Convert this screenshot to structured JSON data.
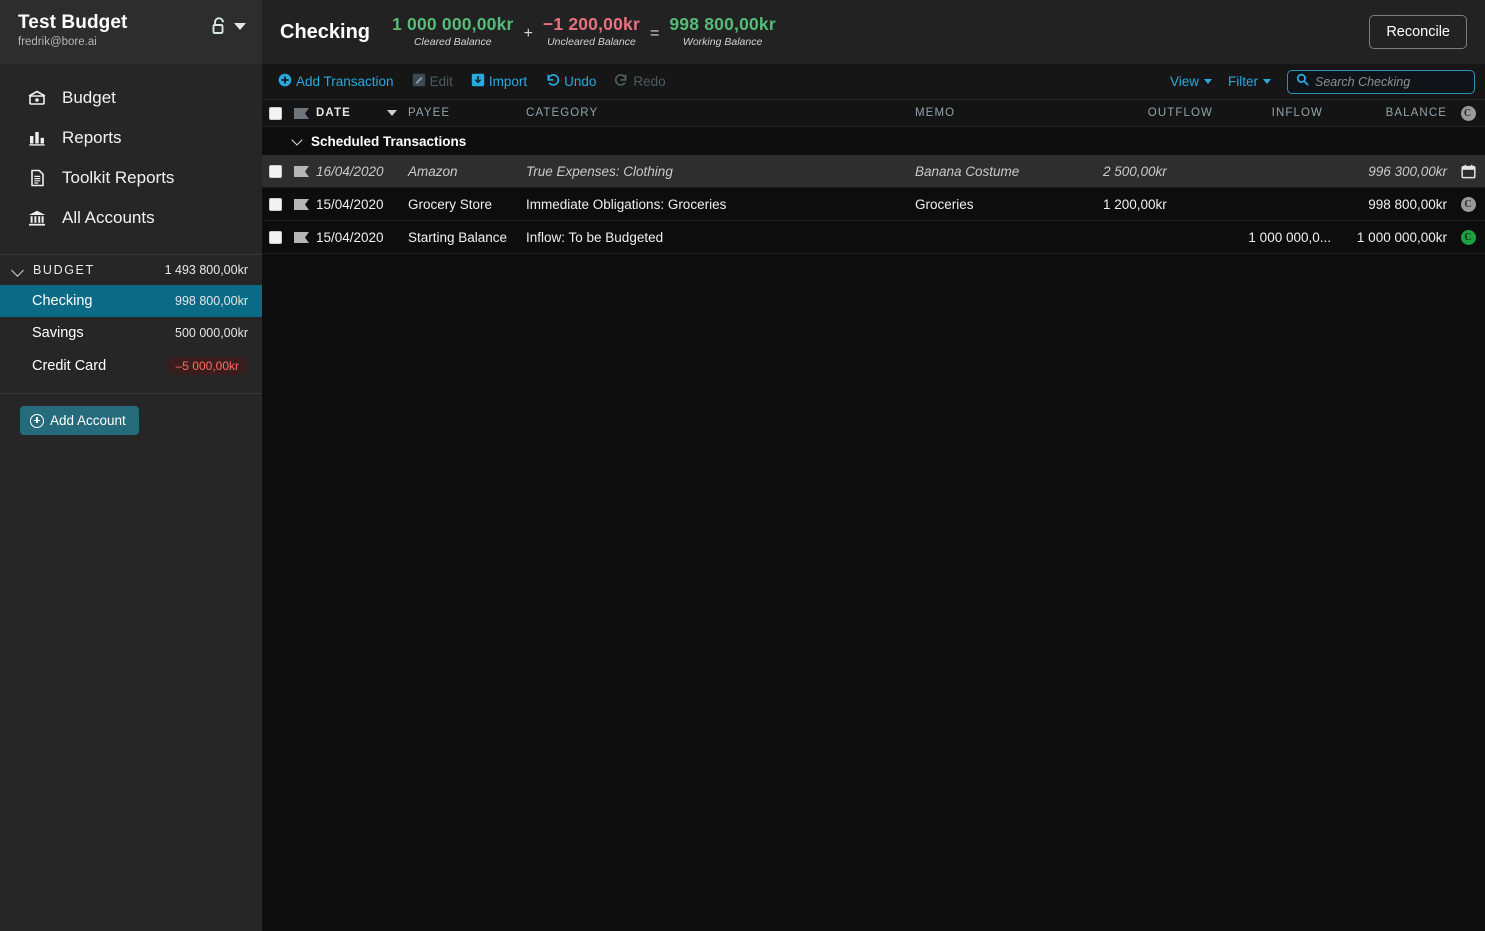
{
  "sidebar": {
    "budget_name": "Test Budget",
    "user_email": "fredrik@bore.ai",
    "lock_icon": "unlock-icon",
    "dropdown_icon": "chevron-down-icon",
    "nav": [
      {
        "label": "Budget",
        "icon": "budget-icon"
      },
      {
        "label": "Reports",
        "icon": "bar-chart-icon"
      },
      {
        "label": "Toolkit Reports",
        "icon": "document-icon"
      },
      {
        "label": "All Accounts",
        "icon": "bank-icon"
      }
    ],
    "group": {
      "label": "BUDGET",
      "amount": "1 493 800,00kr",
      "icon": "chevron-down-icon"
    },
    "accounts": [
      {
        "name": "Checking",
        "balance": "998 800,00kr",
        "selected": true,
        "negative": false
      },
      {
        "name": "Savings",
        "balance": "500 000,00kr",
        "selected": false,
        "negative": false
      },
      {
        "name": "Credit Card",
        "balance": "–5 000,00kr",
        "selected": false,
        "negative": true
      }
    ],
    "add_account_label": "Add Account"
  },
  "header": {
    "account_title": "Checking",
    "balances": [
      {
        "value": "1 000 000,00kr",
        "label": "Cleared Balance",
        "sign": "pos"
      },
      {
        "value": "−1 200,00kr",
        "label": "Uncleared Balance",
        "sign": "neg"
      },
      {
        "value": "998 800,00kr",
        "label": "Working Balance",
        "sign": "pos"
      }
    ],
    "operators": [
      "+",
      "="
    ],
    "reconcile_label": "Reconcile"
  },
  "toolbar": {
    "add_transaction_label": "Add Transaction",
    "edit_label": "Edit",
    "import_label": "Import",
    "undo_label": "Undo",
    "redo_label": "Redo",
    "view_label": "View",
    "filter_label": "Filter",
    "search_placeholder": "Search Checking",
    "search_value": ""
  },
  "grid": {
    "columns": {
      "date": "DATE",
      "payee": "PAYEE",
      "category": "CATEGORY",
      "memo": "MEMO",
      "outflow": "OUTFLOW",
      "inflow": "INFLOW",
      "balance": "BALANCE",
      "status": "C"
    },
    "group_label": "Scheduled Transactions",
    "rows": [
      {
        "date": "16/04/2020",
        "payee": "Amazon",
        "category": "True Expenses: Clothing",
        "memo": "Banana Costume",
        "outflow": "2 500,00kr",
        "inflow": "",
        "balance": "996 300,00kr",
        "status": "scheduled",
        "status_icon": "calendar-icon"
      },
      {
        "date": "15/04/2020",
        "payee": "Grocery Store",
        "category": "Immediate Obligations: Groceries",
        "memo": "Groceries",
        "outflow": "1 200,00kr",
        "inflow": "",
        "balance": "998 800,00kr",
        "status": "uncleared",
        "status_icon": "uncleared-icon",
        "status_text": "C"
      },
      {
        "date": "15/04/2020",
        "payee": "Starting Balance",
        "category": "Inflow: To be Budgeted",
        "memo": "",
        "outflow": "",
        "inflow": "1 000 000,0...",
        "balance": "1 000 000,00kr",
        "status": "cleared",
        "status_icon": "cleared-icon",
        "status_text": "C"
      }
    ]
  },
  "colors": {
    "accent": "#28a9e0",
    "selected_account": "#0b6a85",
    "positive": "#55bb77",
    "negative": "#e8717f",
    "cleared_green": "#1fa03f"
  }
}
